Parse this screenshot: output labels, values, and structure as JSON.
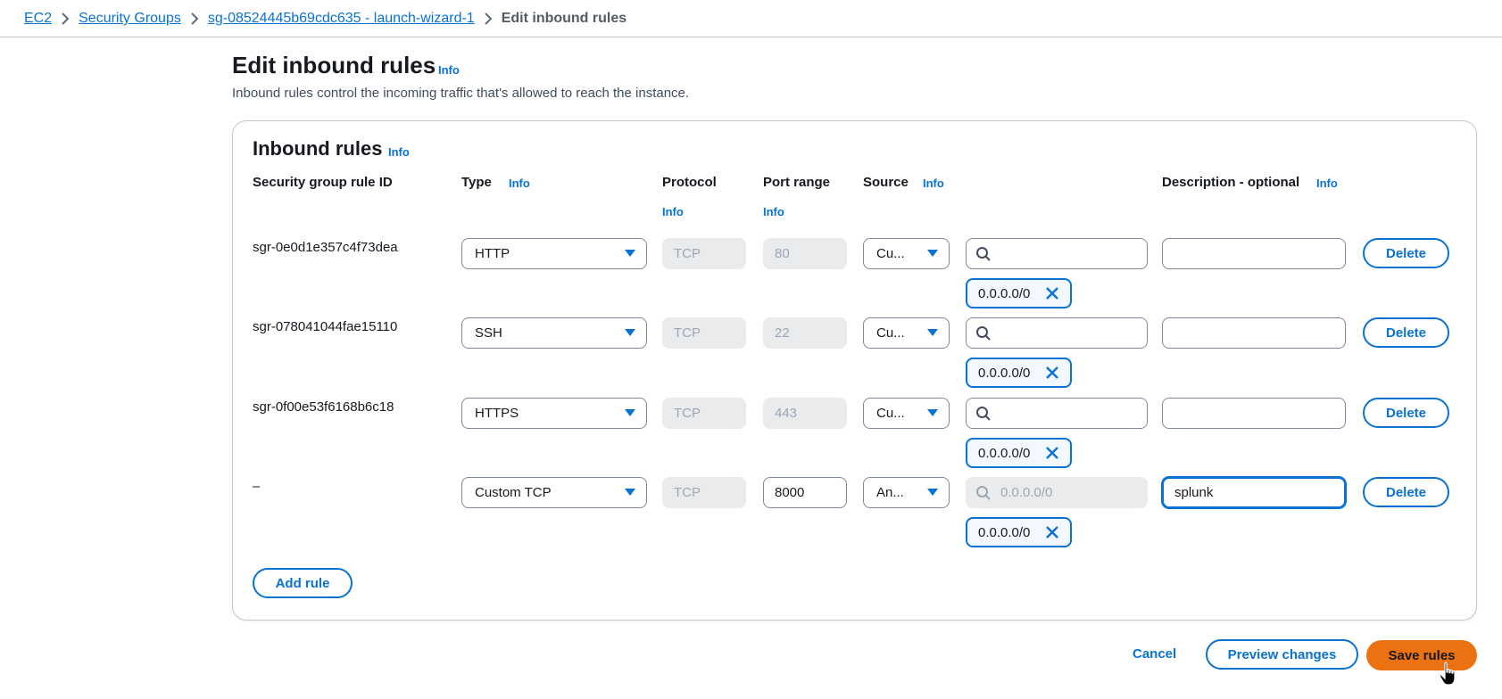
{
  "breadcrumb": {
    "items": [
      "EC2",
      "Security Groups",
      "sg-08524445b69cdc635 - launch-wizard-1"
    ],
    "current": "Edit inbound rules"
  },
  "header": {
    "title": "Edit inbound rules",
    "info": "Info",
    "description": "Inbound rules control the incoming traffic that's allowed to reach the instance."
  },
  "panel": {
    "title": "Inbound rules",
    "info": "Info",
    "columns": {
      "rule_id": "Security group rule ID",
      "type": "Type",
      "protocol": "Protocol",
      "port_range": "Port range",
      "source": "Source",
      "description": "Description - optional",
      "info": "Info"
    },
    "rows": [
      {
        "rule_id": "sgr-0e0d1e357c4f73dea",
        "type": "HTTP",
        "protocol": "TCP",
        "port": "80",
        "source": "Cu...",
        "search": "",
        "token": "0.0.0.0/0",
        "description": ""
      },
      {
        "rule_id": "sgr-078041044fae15110",
        "type": "SSH",
        "protocol": "TCP",
        "port": "22",
        "source": "Cu...",
        "search": "",
        "token": "0.0.0.0/0",
        "description": ""
      },
      {
        "rule_id": "sgr-0f00e53f6168b6c18",
        "type": "HTTPS",
        "protocol": "TCP",
        "port": "443",
        "source": "Cu...",
        "search": "",
        "token": "0.0.0.0/0",
        "description": ""
      },
      {
        "rule_id": "–",
        "type": "Custom TCP",
        "protocol": "TCP",
        "port": "8000",
        "source": "An...",
        "search_placeholder": "0.0.0.0/0",
        "token": "0.0.0.0/0",
        "description": "splunk"
      }
    ],
    "delete_label": "Delete",
    "add_rule_label": "Add rule"
  },
  "footer": {
    "cancel": "Cancel",
    "preview": "Preview changes",
    "save": "Save rules"
  },
  "colors": {
    "link": "#0972d3",
    "primary": "#ec7211"
  }
}
